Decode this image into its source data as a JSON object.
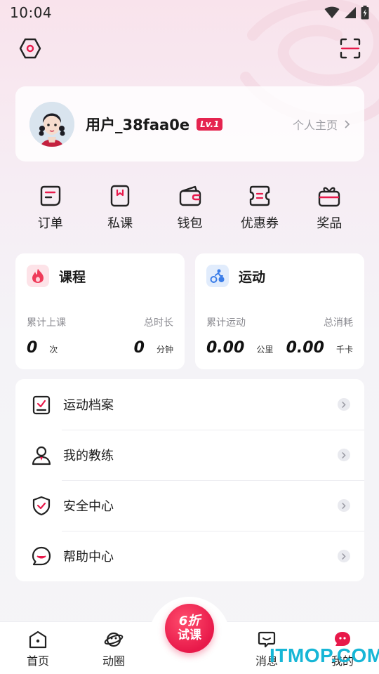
{
  "status_bar": {
    "time": "10:04"
  },
  "profile": {
    "username": "用户_38faa0e",
    "level": "Lv.1",
    "homepage_link": "个人主页"
  },
  "quick_actions": [
    {
      "label": "订单",
      "icon": "order-icon"
    },
    {
      "label": "私课",
      "icon": "private-class-icon"
    },
    {
      "label": "钱包",
      "icon": "wallet-icon"
    },
    {
      "label": "优惠券",
      "icon": "coupon-icon"
    },
    {
      "label": "奖品",
      "icon": "gift-icon"
    }
  ],
  "courses_card": {
    "title": "课程",
    "left_label": "累计上课",
    "left_value": "0",
    "left_unit": "次",
    "right_label": "总时长",
    "right_value": "0",
    "right_unit": "分钟"
  },
  "sports_card": {
    "title": "运动",
    "left_label": "累计运动",
    "left_value": "0.00",
    "left_unit": "公里",
    "right_label": "总消耗",
    "right_value": "0.00",
    "right_unit": "千卡"
  },
  "menu": [
    {
      "label": "运动档案",
      "icon": "sports-record-icon"
    },
    {
      "label": "我的教练",
      "icon": "coach-icon"
    },
    {
      "label": "安全中心",
      "icon": "shield-icon"
    },
    {
      "label": "帮助中心",
      "icon": "help-chat-icon"
    }
  ],
  "tabbar": {
    "home": "首页",
    "community": "动圈",
    "promo_line1": "6折",
    "promo_line2": "试课",
    "messages": "消息",
    "me": "我的"
  },
  "watermark": "ITMOP.COM",
  "colors": {
    "accent": "#e8194a",
    "watermark": "#17b6d6"
  }
}
